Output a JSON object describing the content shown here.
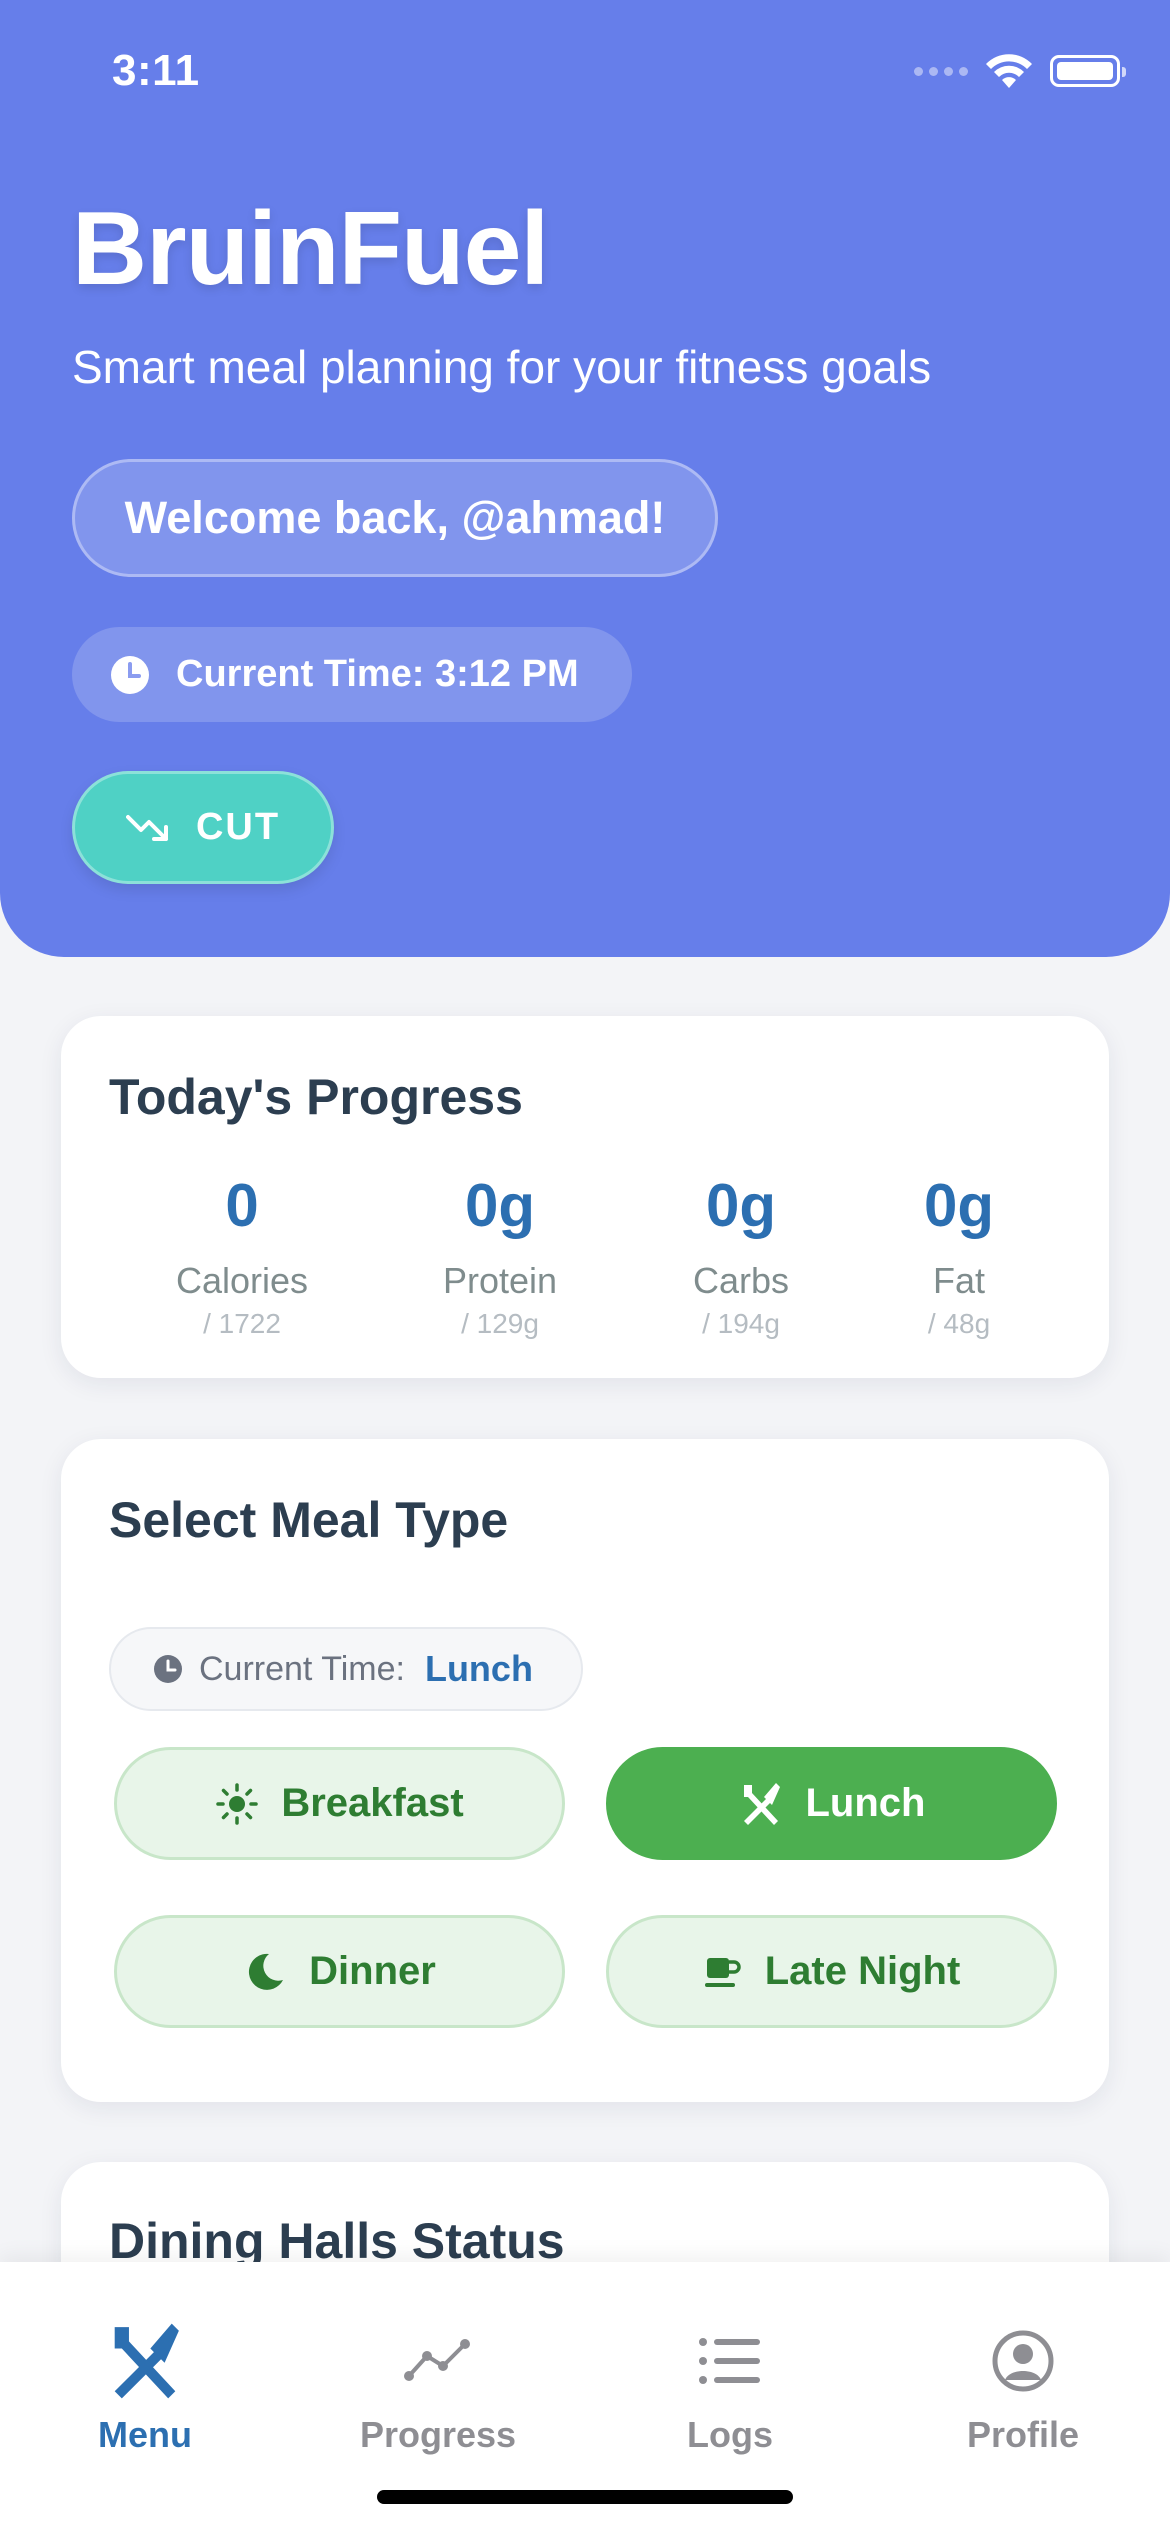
{
  "status_bar": {
    "time": "3:11"
  },
  "header": {
    "title": "BruinFuel",
    "subtitle": "Smart meal planning for your fitness goals",
    "welcome": "Welcome back, @ahmad!",
    "current_time": "Current Time: 3:12 PM",
    "goal_label": "CUT"
  },
  "progress": {
    "title": "Today's Progress",
    "macros": [
      {
        "value": "0",
        "label": "Calories",
        "goal": "/ 1722"
      },
      {
        "value": "0g",
        "label": "Protein",
        "goal": "/ 129g"
      },
      {
        "value": "0g",
        "label": "Carbs",
        "goal": "/ 194g"
      },
      {
        "value": "0g",
        "label": "Fat",
        "goal": "/ 48g"
      }
    ]
  },
  "meal_type": {
    "title": "Select Meal Type",
    "current_time_label": "Current Time:",
    "current_time_value": "Lunch",
    "options": [
      {
        "label": "Breakfast",
        "icon": "sun-icon",
        "selected": false
      },
      {
        "label": "Lunch",
        "icon": "utensils-icon",
        "selected": true
      },
      {
        "label": "Dinner",
        "icon": "moon-icon",
        "selected": false
      },
      {
        "label": "Late Night",
        "icon": "coffee-cup-icon",
        "selected": false
      }
    ]
  },
  "dining": {
    "title": "Dining Halls Status"
  },
  "tabbar": {
    "tabs": [
      {
        "label": "Menu",
        "icon": "utensils-icon",
        "active": true
      },
      {
        "label": "Progress",
        "icon": "line-chart-icon",
        "active": false
      },
      {
        "label": "Logs",
        "icon": "list-icon",
        "active": false
      },
      {
        "label": "Profile",
        "icon": "user-circle-icon",
        "active": false
      }
    ]
  },
  "colors": {
    "header": "#667eea",
    "accent_teal": "#4fd1c5",
    "macro_value": "#2c6fb1",
    "meal_active": "#4caf50",
    "meal_inactive_bg": "#e8f5e9",
    "meal_inactive_text": "#2e7d32"
  }
}
